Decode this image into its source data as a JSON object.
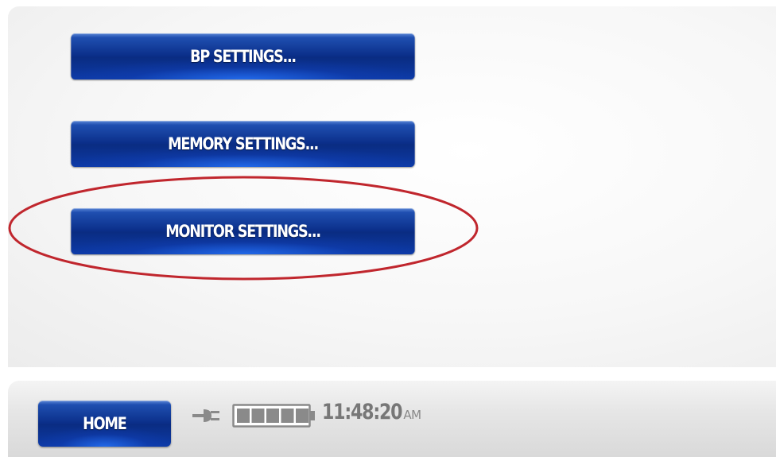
{
  "menu": {
    "bp_settings_label": "BP SETTINGS...",
    "memory_settings_label": "MEMORY SETTINGS...",
    "monitor_settings_label": "MONITOR SETTINGS..."
  },
  "status_bar": {
    "home_label": "HOME",
    "power_icon": "plug-icon",
    "battery_icon": "battery-icon",
    "battery_level": 1.0,
    "time": "11:48:20",
    "ampm": "AM"
  },
  "annotation": {
    "highlighted_item": "monitor-settings-button",
    "highlight_color": "#c0262d"
  },
  "colors": {
    "button_dark": "#0a2c82",
    "button_glow": "#2878ff",
    "text_gray": "#777777"
  }
}
